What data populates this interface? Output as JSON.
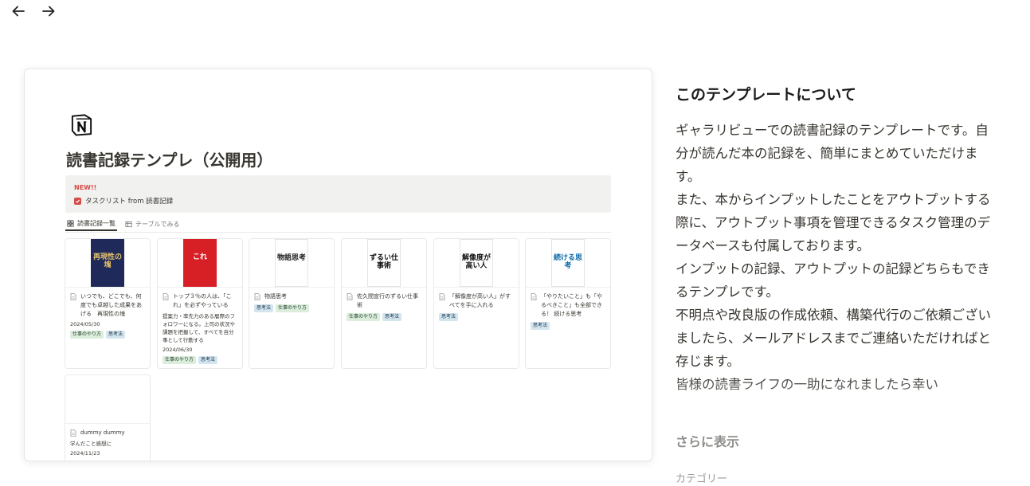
{
  "nav": {
    "back_icon": "arrow-left-icon",
    "forward_icon": "arrow-right-icon"
  },
  "preview": {
    "logo": "notion-logo",
    "title": "読書記録テンプレ（公開用）",
    "callout": {
      "new_label": "NEW!!",
      "task_label": "タスクリスト from 読書記録"
    },
    "views": [
      {
        "label": "読書記録一覧",
        "icon": "gallery-icon"
      },
      {
        "label": "テーブルでみる",
        "icon": "table-icon"
      }
    ],
    "cards": [
      {
        "title": "いつでも、どこでも、何度でも卓越した成果をあげる　再現性の塊",
        "desc": "",
        "date": "2024/05/30",
        "tags": [
          "仕事のやり方",
          "思考法"
        ],
        "cover_text": "再現性の塊",
        "cover_bg": "#1f2a5a",
        "cover_fg": "#e8c46a"
      },
      {
        "title": "トップ３％の人は、「これ」を必ずやっている",
        "desc": "提案力・率先力のある層際のフォロワーになる。上司の状況や課題を把握して、すべてを自分事として行動する",
        "date": "2024/06/30",
        "tags": [
          "仕事のやり方",
          "思考法"
        ],
        "cover_text": "これ",
        "cover_bg": "#d71f26",
        "cover_fg": "#ffffff"
      },
      {
        "title": "物語思考",
        "desc": "",
        "date": "",
        "tags": [
          "思考法",
          "仕事のやり方"
        ],
        "cover_text": "物語思考",
        "cover_bg": "#ffffff",
        "cover_fg": "#222222"
      },
      {
        "title": "佐久間宣行のずるい仕事術",
        "desc": "",
        "date": "",
        "tags": [
          "仕事のやり方",
          "思考法"
        ],
        "cover_text": "ずるい仕事術",
        "cover_bg": "#ffffff",
        "cover_fg": "#111111"
      },
      {
        "title": "「解像度が高い人」がすべてを手に入れる",
        "desc": "",
        "date": "",
        "tags": [
          "思考法"
        ],
        "cover_text": "解像度が高い人",
        "cover_bg": "#ffffff",
        "cover_fg": "#111111"
      },
      {
        "title": "「やりたいこと」も「やるべきこと」も全部できる！ 続ける思考",
        "desc": "",
        "date": "",
        "tags": [
          "思考法"
        ],
        "cover_text": "続ける思考",
        "cover_bg": "#ffffff",
        "cover_fg": "#0d6aa8"
      },
      {
        "title": "dummy dummy",
        "desc": "学んだこと感想に",
        "date": "2024/11/23",
        "tags": [],
        "cover_text": "",
        "cover_bg": "#ffffff",
        "cover_fg": "#111111"
      }
    ]
  },
  "side": {
    "heading": "このテンプレートについて",
    "description": "ギャラリビューでの読書記録のテンプレートです。自分が読んだ本の記録を、簡単にまとめていただけます。\nまた、本からインプットしたことをアウトプットする際に、アウトプット事項を管理できるタスク管理のデータベースも付属しております。\nインプットの記録、アウトプットの記録どちらもできるテンプレです。\n不明点や改良版の作成依頼、構築代行のご依頼ございましたら、メールアドレスまでご連絡いただければと存じます。\n皆様の読書ライフの一助になれましたら幸い",
    "show_more": "さらに表示",
    "category_label": "カテゴリー"
  },
  "colors": {
    "accent_red": "#d44c47",
    "tag_green": "#dbeddb",
    "tag_blue": "#d3e5ef",
    "muted": "#9b9a97"
  }
}
